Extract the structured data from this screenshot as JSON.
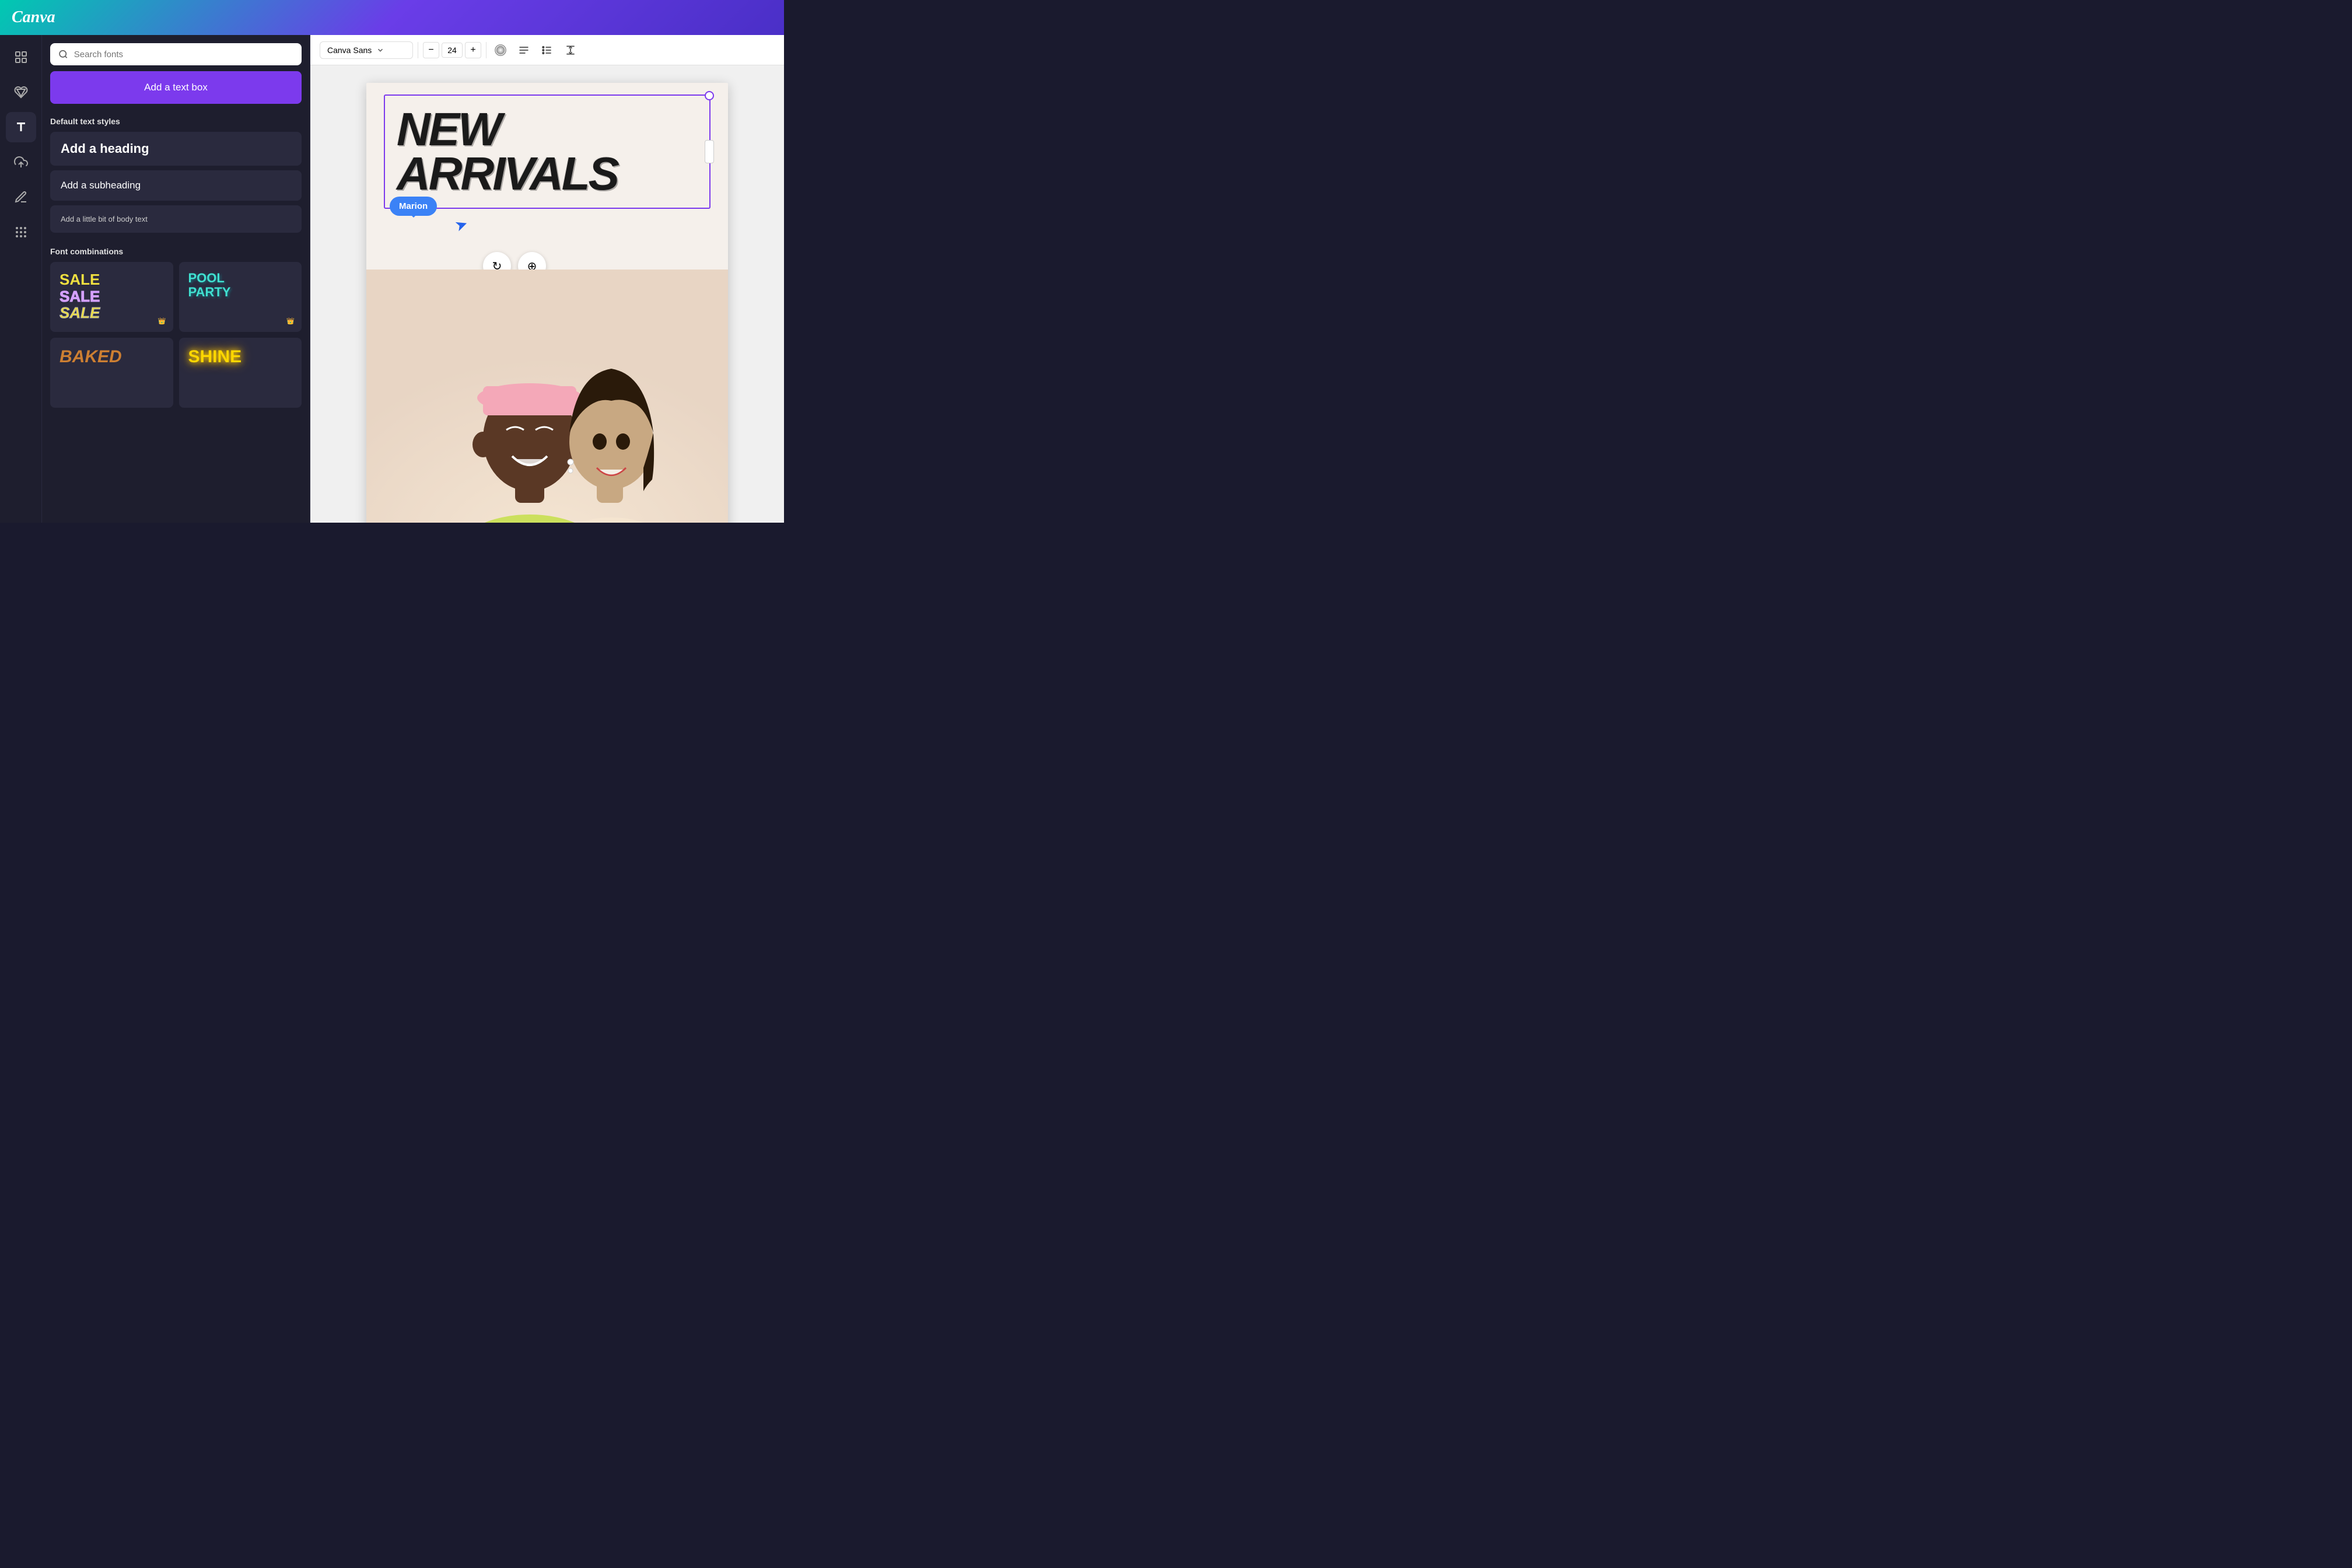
{
  "header": {
    "logo": "Canva",
    "gradient_start": "#00c9b1",
    "gradient_end": "#4a2fc7"
  },
  "toolbar": {
    "font_name": "Canva Sans",
    "font_size": "24",
    "font_size_label": "24",
    "decrease_label": "−",
    "increase_label": "+"
  },
  "text_panel": {
    "search_placeholder": "Search fonts",
    "add_text_box_label": "Add a text box",
    "default_styles_label": "Default text styles",
    "heading_label": "Add a heading",
    "subheading_label": "Add a subheading",
    "body_label": "Add a little bit of body text",
    "font_combinations_label": "Font combinations",
    "font_card1_line1": "SALE",
    "font_card1_line2": "SALE",
    "font_card1_line3": "SALE",
    "font_card2_line1": "POOL",
    "font_card2_line2": "PARTY",
    "font_card3": "BAKED",
    "font_card4": "SHINE"
  },
  "canvas": {
    "title_line1": "NEW",
    "title_line2": "ARRIVALS",
    "tooltip_label": "Marion"
  },
  "icons": {
    "layout_icon": "⊞",
    "elements_icon": "♡△",
    "text_icon": "T",
    "upload_icon": "↑",
    "draw_icon": "✏",
    "apps_icon": "⋯",
    "search_unicode": "🔍",
    "chevron_down": "▾",
    "align_left": "≡",
    "list_icon": "☰",
    "spacing_icon": "↕",
    "cursor_unicode": "➤",
    "rotate_unicode": "↻",
    "move_unicode": "⊕"
  },
  "colors": {
    "purple_accent": "#7c3aed",
    "blue_tooltip": "#3b82f6",
    "dark_bg": "#1e1e2e",
    "header_gradient": "linear-gradient(135deg, #00c9b1, #6a3de8)"
  }
}
